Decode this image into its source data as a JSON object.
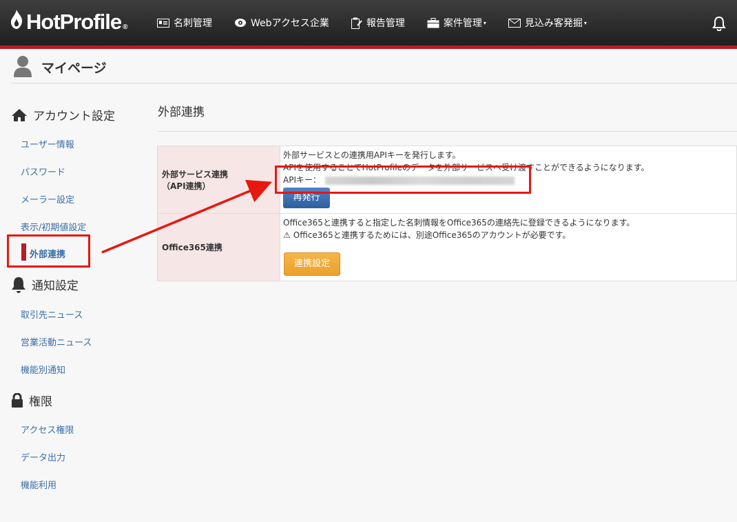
{
  "brand": {
    "name": "HotProfile",
    "reg": "®"
  },
  "nav": {
    "items": [
      {
        "label": "名刺管理",
        "icon": "card-icon"
      },
      {
        "label": "Webアクセス企業",
        "icon": "eye-icon"
      },
      {
        "label": "報告管理",
        "icon": "report-icon"
      },
      {
        "label": "案件管理",
        "icon": "briefcase-icon",
        "caret": "▾"
      },
      {
        "label": "見込み客発掘",
        "icon": "envelope-icon",
        "caret": "▾"
      }
    ]
  },
  "page": {
    "title": "マイページ"
  },
  "sidebar": {
    "account": {
      "heading": "アカウント設定",
      "links": [
        "ユーザー情報",
        "パスワード",
        "メーラー設定",
        "表示/初期値設定"
      ],
      "active": "外部連携"
    },
    "notify": {
      "heading": "通知設定",
      "links": [
        "取引先ニュース",
        "営業活動ニュース",
        "機能別通知"
      ]
    },
    "perm": {
      "heading": "権限",
      "links": [
        "アクセス権限",
        "データ出力",
        "機能利用"
      ]
    }
  },
  "main": {
    "title": "外部連携",
    "rows": {
      "api": {
        "label1": "外部サービス連携",
        "label2": "（API連携）",
        "line1": "外部サービスとの連携用APIキーを発行します。",
        "line2": "APIを使用することでHotProfileのデータを外部サービスへ受け渡すことができるようになります。",
        "key_label": "APIキー：",
        "button": "再発行"
      },
      "office": {
        "label": "Office365連携",
        "line1": "Office365と連携すると指定した名刺情報をOffice365の連絡先に登録できるようになります。",
        "warn_icon": "⚠",
        "line2": "Office365と連携するためには、別途Office365のアカウントが必要です。",
        "button": "連携設定"
      }
    }
  },
  "colors": {
    "accent": "#b21f25",
    "link": "#3a6fa8",
    "annotation": "#e8170f"
  }
}
